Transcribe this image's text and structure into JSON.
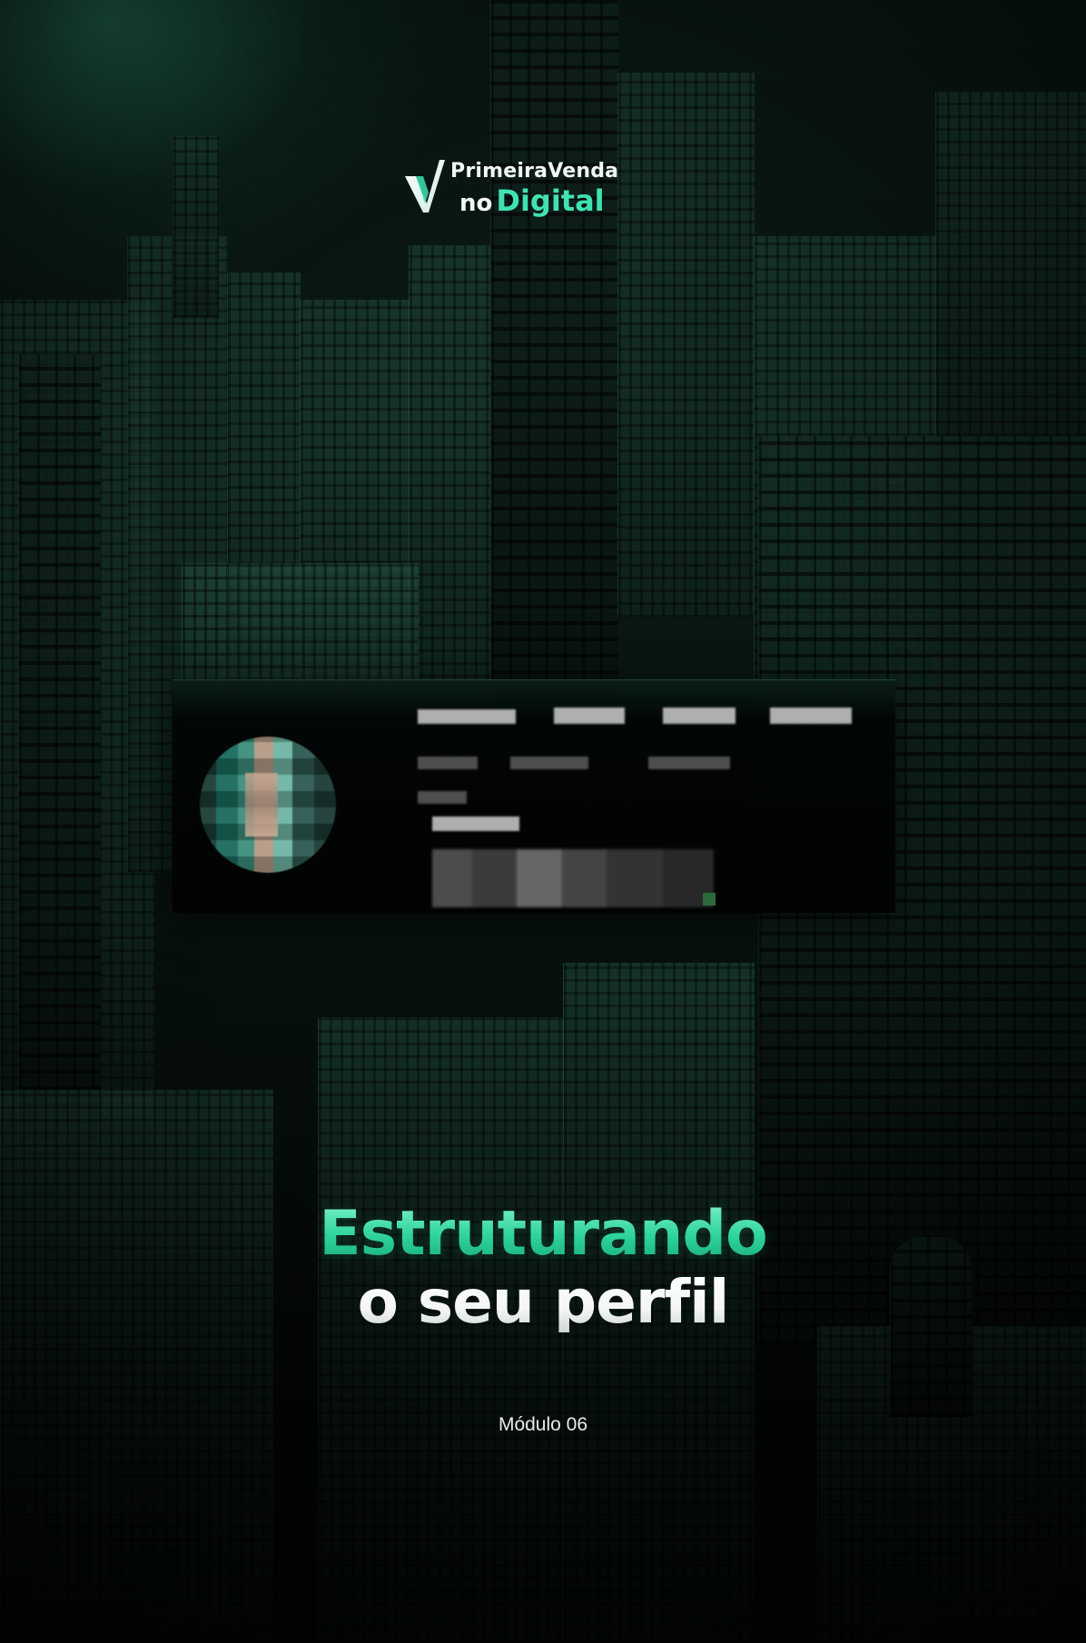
{
  "logo": {
    "line1": "PrimeiraVenda",
    "line2_prefix": "no",
    "line2_highlight": "Digital",
    "accent_color": "#3fe2b0",
    "icon": "v-checkmark-icon"
  },
  "title": {
    "line1": "Estruturando",
    "line2": "o seu perfil",
    "line1_color": "#3ddfa9",
    "line2_color": "#ffffff"
  },
  "module_label": "Módulo 06",
  "profile_card": {
    "avatar_icon": "blurred-avatar"
  },
  "colors": {
    "background": "#07110f",
    "accent": "#3ddfa9"
  }
}
